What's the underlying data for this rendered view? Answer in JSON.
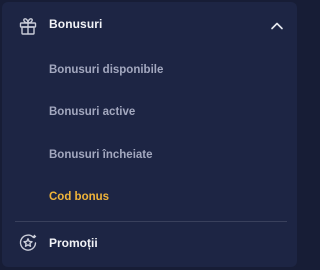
{
  "menu": {
    "header": {
      "label": "Bonusuri",
      "icon": "gift-icon",
      "expanded_icon": "chevron-up-icon"
    },
    "submenu": [
      {
        "label": "Bonusuri disponibile",
        "active": false
      },
      {
        "label": "Bonusuri active",
        "active": false
      },
      {
        "label": "Bonusuri încheiate",
        "active": false
      },
      {
        "label": "Cod bonus",
        "active": true
      }
    ],
    "promotions": {
      "label": "Promoții",
      "icon": "promotions-star-icon"
    }
  },
  "colors": {
    "background": "#171d36",
    "panel": "#1d2544",
    "text": "#f2f3f7",
    "muted_text": "#a3a8bf",
    "accent": "#f0b43a",
    "divider": "#39405c"
  }
}
